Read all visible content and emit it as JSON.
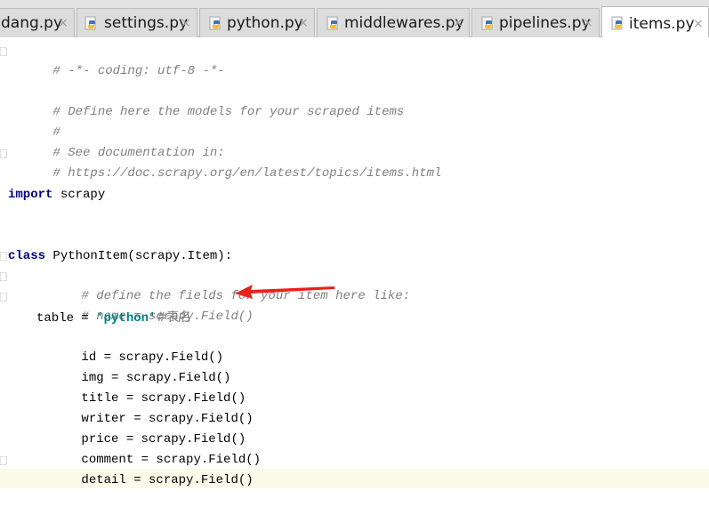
{
  "tabs": [
    {
      "label": "dang.py",
      "close": "×"
    },
    {
      "label": "settings.py",
      "close": "×"
    },
    {
      "label": "python.py",
      "close": "×"
    },
    {
      "label": "middlewares.py",
      "close": "×"
    },
    {
      "label": "pipelines.py",
      "close": "×"
    },
    {
      "label": "items.py",
      "close": "×"
    }
  ],
  "active_tab": "items.py",
  "editor": {
    "lines": {
      "l1": "# -*- coding: utf-8 -*-",
      "l2": "# Define here the models for your scraped items",
      "l3": "#",
      "l4": "# See documentation in:",
      "l5": "# https://doc.scrapy.org/en/latest/topics/items.html",
      "l6_kw": "import",
      "l6_rest": " scrapy",
      "l7_kw": "class",
      "l7_rest": " PythonItem(scrapy.Item):",
      "l8": "# define the fields for your item here like:",
      "l9": "# name = scrapy.Field()",
      "l10_a": "table = ",
      "l10_str": "'python'",
      "l10_comment": "#表名",
      "l11": "id = scrapy.Field()",
      "l12": "img = scrapy.Field()",
      "l13": "title = scrapy.Field()",
      "l14": "writer = scrapy.Field()",
      "l15": "price = scrapy.Field()",
      "l16": "comment = scrapy.Field()",
      "l17": "detail = scrapy.Field()"
    }
  },
  "colors": {
    "arrow": "#e8211b",
    "comment": "#808080",
    "keyword": "#000080",
    "string": "#008080"
  },
  "icons": {
    "python_file": "python-file-icon",
    "close": "close-icon",
    "annotation_arrow": "arrow-icon"
  }
}
